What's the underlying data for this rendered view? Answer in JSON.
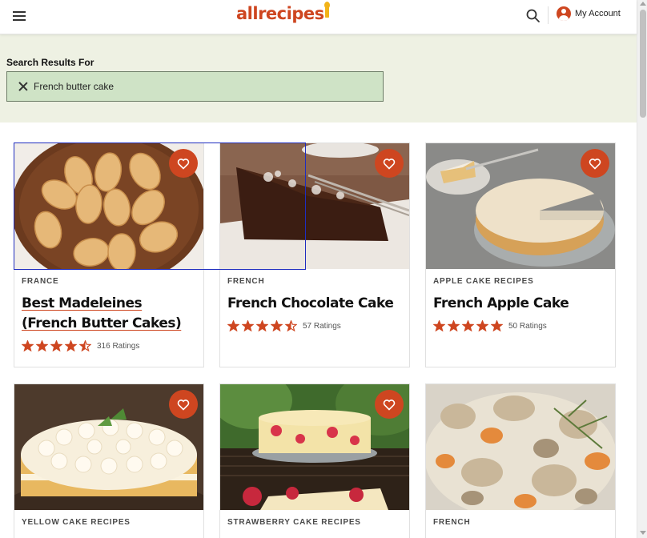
{
  "header": {
    "logo_text": "allrecipes",
    "account_label": "My Account",
    "icons": {
      "menu": "hamburger-icon",
      "search": "search-icon",
      "account": "account-icon"
    },
    "accent_color": "#ce4620"
  },
  "search": {
    "heading": "Search Results For",
    "value": "French butter cake",
    "band_color": "#eef1e3",
    "box_color": "#cfe3c6"
  },
  "cards": [
    {
      "category": "FRANCE",
      "title": "Best Madeleines (French Butter Cakes)",
      "rating": 4.5,
      "ratings_text": "316 Ratings",
      "image": "madeleines-photo"
    },
    {
      "category": "FRENCH",
      "title": "French Chocolate Cake",
      "rating": 4.5,
      "ratings_text": "57 Ratings",
      "image": "chocolate-cake-photo"
    },
    {
      "category": "APPLE CAKE RECIPES",
      "title": "French Apple Cake",
      "rating": 5,
      "ratings_text": "50 Ratings",
      "image": "apple-cake-photo"
    },
    {
      "category": "YELLOW CAKE RECIPES",
      "title": "",
      "image": "yellow-cake-photo"
    },
    {
      "category": "STRAWBERRY CAKE RECIPES",
      "title": "",
      "image": "strawberry-cake-photo"
    },
    {
      "category": "FRENCH",
      "title": "",
      "image": "chicken-stew-photo"
    }
  ]
}
